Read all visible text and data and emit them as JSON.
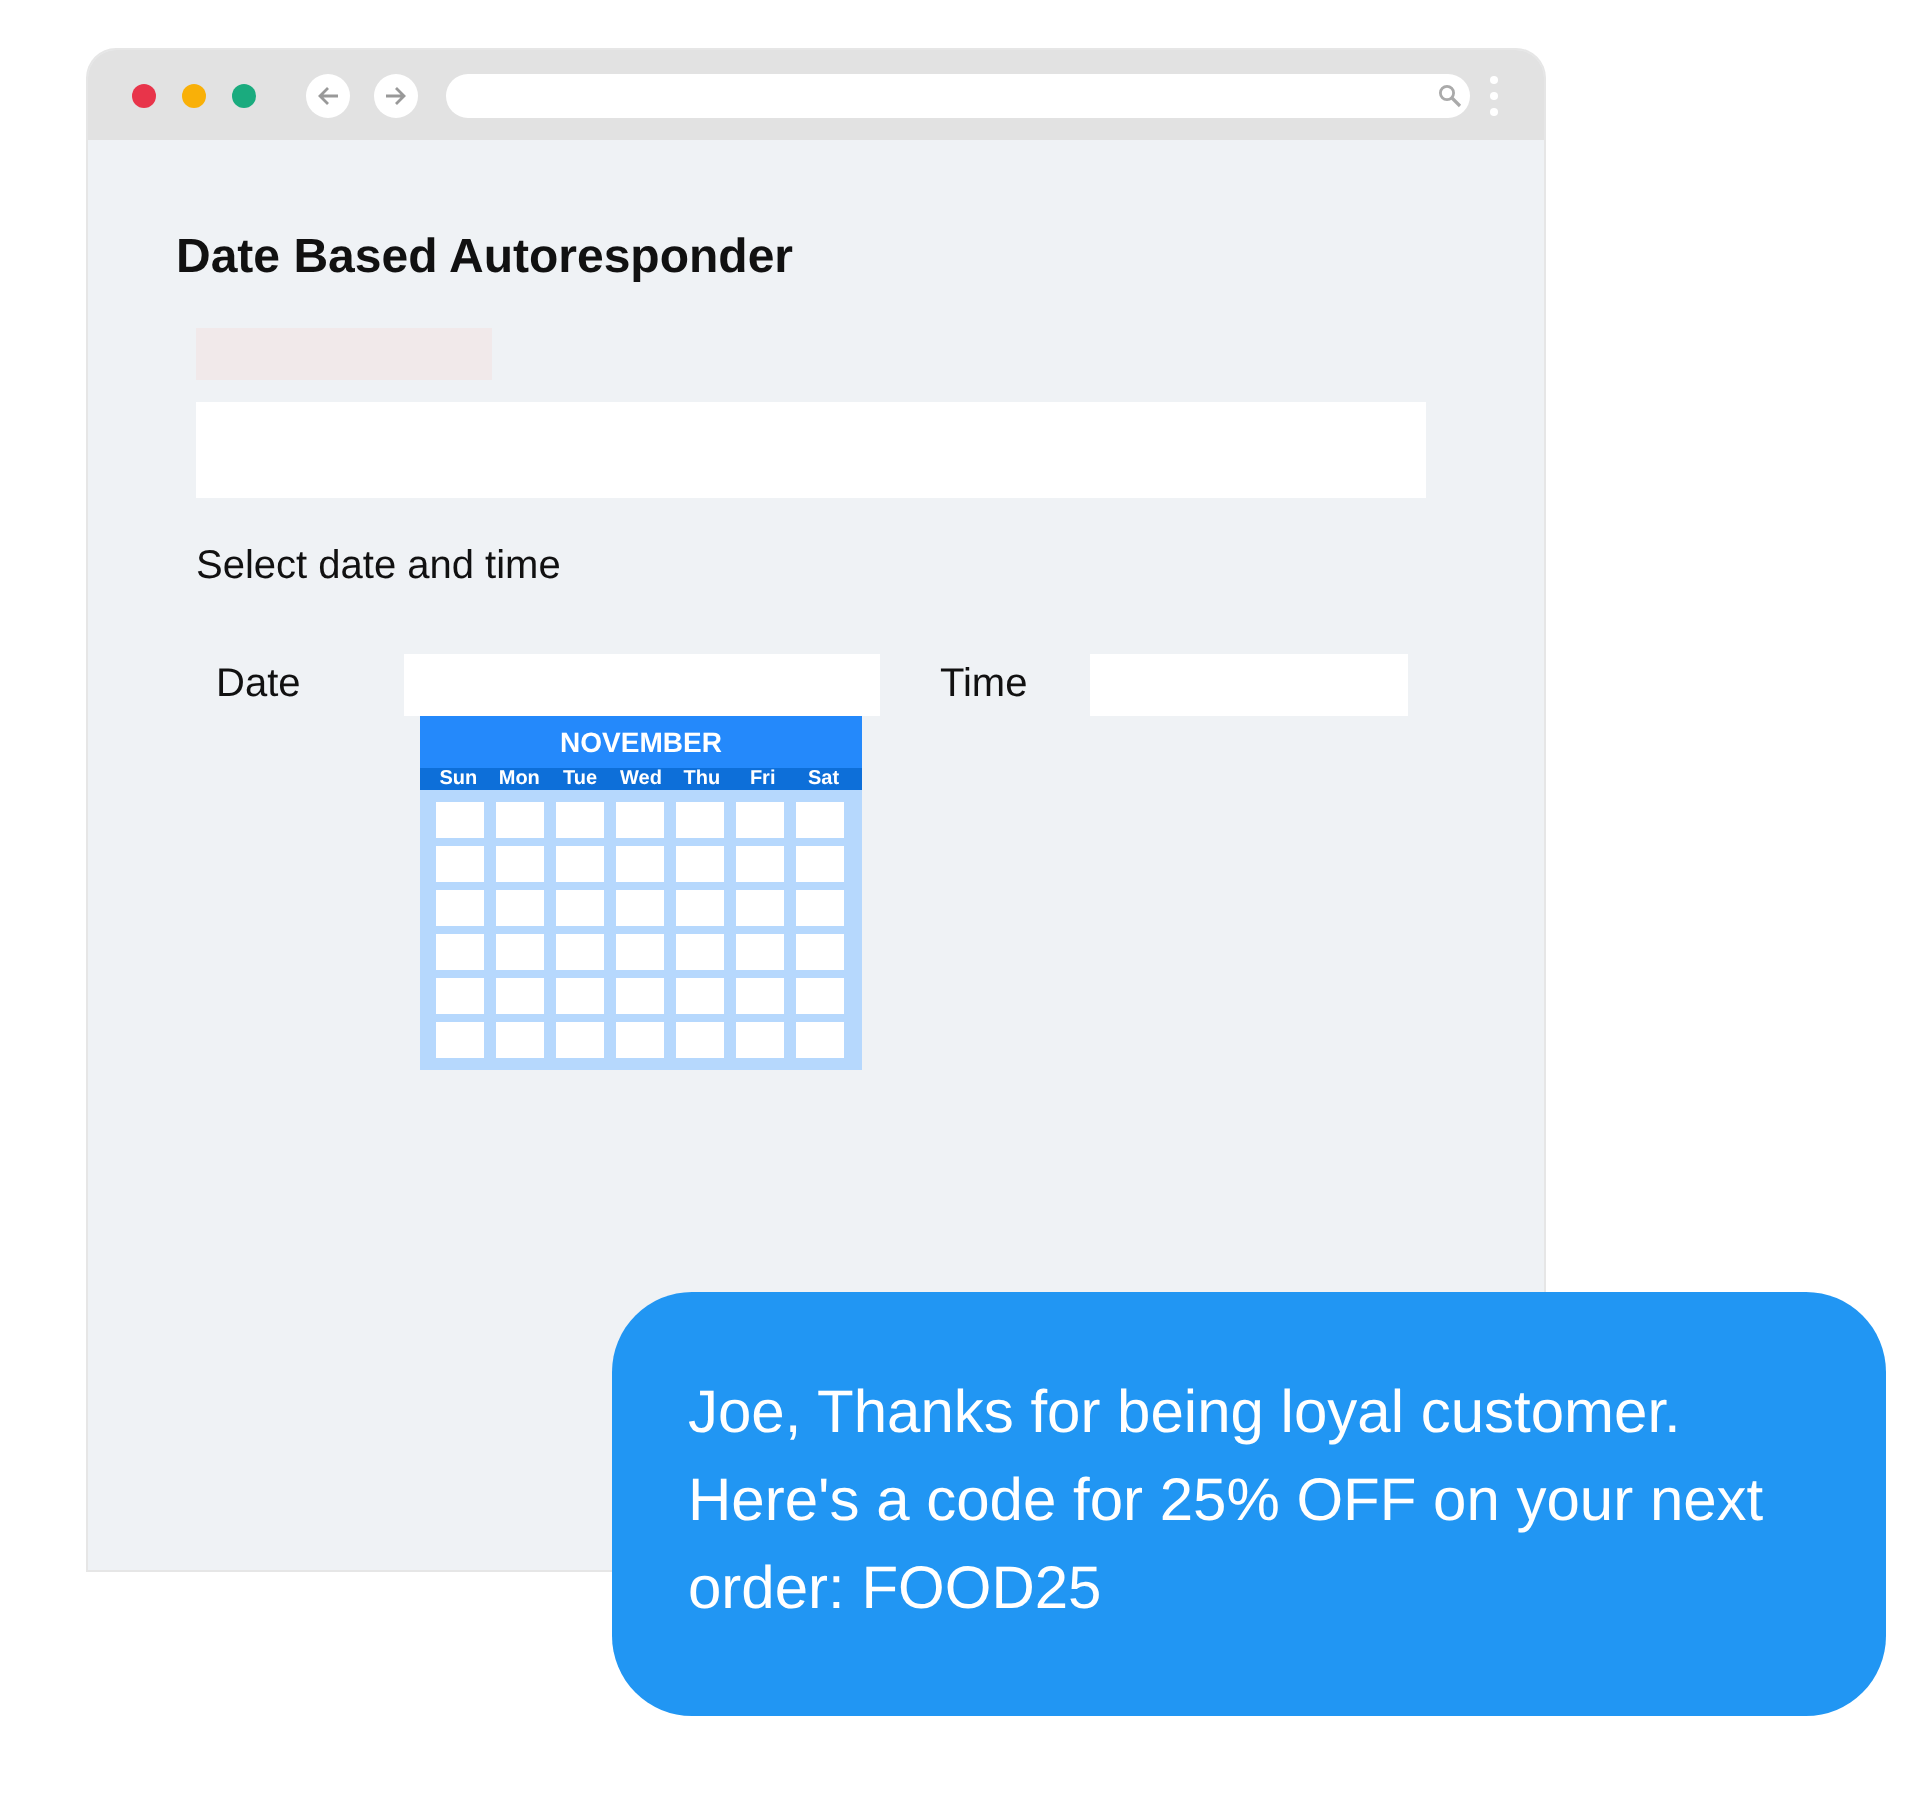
{
  "page": {
    "heading": "Date Based Autoresponder",
    "prompt": "Select date and time"
  },
  "date_picker": {
    "label": "Date",
    "calendar": {
      "month": "NOVEMBER",
      "weekdays": [
        "Sun",
        "Mon",
        "Tue",
        "Wed",
        "Thu",
        "Fri",
        "Sat"
      ]
    }
  },
  "time_picker": {
    "label": "Time"
  },
  "message": {
    "text": "Joe, Thanks for being loyal customer. Here's a code for  25% OFF on your next order: FOOD25"
  }
}
